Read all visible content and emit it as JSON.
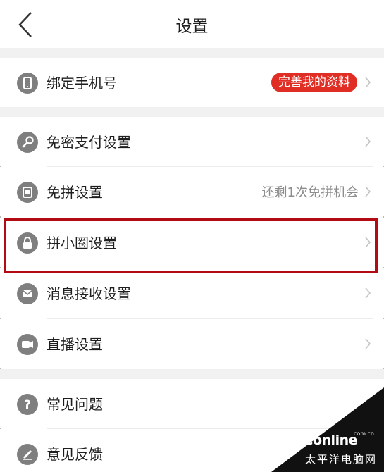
{
  "header": {
    "title": "设置"
  },
  "items": [
    {
      "label": "绑定手机号",
      "icon": "phone-icon",
      "badge": "完善我的资料"
    },
    {
      "label": "免密支付设置",
      "icon": "key-icon"
    },
    {
      "label": "免拼设置",
      "icon": "card-icon",
      "value": "还剩1次免拼机会"
    },
    {
      "label": "拼小圈设置",
      "icon": "lock-icon"
    },
    {
      "label": "消息接收设置",
      "icon": "mail-icon"
    },
    {
      "label": "直播设置",
      "icon": "video-icon"
    },
    {
      "label": "常见问题",
      "icon": "question-icon"
    },
    {
      "label": "意见反馈",
      "icon": "pen-icon"
    }
  ],
  "watermark": {
    "logo": "PConline",
    "domain": ".com.cn",
    "sub": "太平洋电脑网"
  },
  "colors": {
    "badge": "#e02e24",
    "highlight": "#b20b14",
    "icon": "#7f7f7f"
  }
}
